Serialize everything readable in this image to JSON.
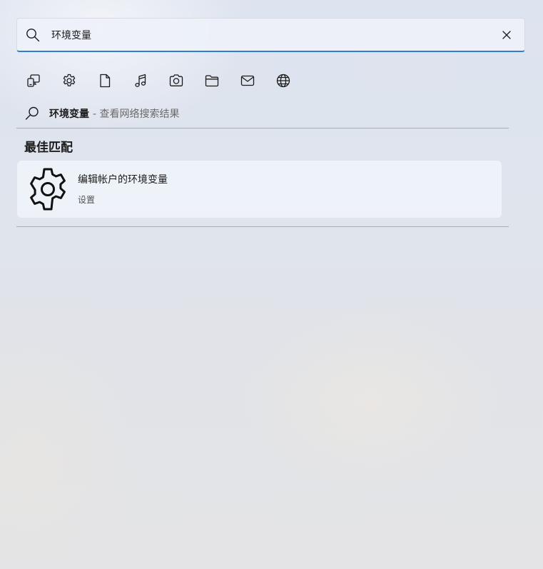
{
  "search": {
    "value": "环境变量",
    "placeholder": ""
  },
  "filters": [
    {
      "icon": "apps-icon",
      "label": "应用"
    },
    {
      "icon": "gear-icon",
      "label": "设置"
    },
    {
      "icon": "document-icon",
      "label": "文档"
    },
    {
      "icon": "music-icon",
      "label": "音乐"
    },
    {
      "icon": "camera-icon",
      "label": "照片"
    },
    {
      "icon": "folder-icon",
      "label": "文件夹"
    },
    {
      "icon": "mail-icon",
      "label": "电子邮件"
    },
    {
      "icon": "globe-icon",
      "label": "网络"
    }
  ],
  "web_search": {
    "query": "环境变量",
    "suffix": "- 查看网络搜索结果"
  },
  "best_match": {
    "section_title": "最佳匹配",
    "title": "编辑帐户的环境变量",
    "subtitle": "设置",
    "icon": "gear-icon"
  },
  "colors": {
    "accent": "#2f7fd1",
    "text": "#1b1b1b",
    "muted": "#6a6a6a"
  }
}
